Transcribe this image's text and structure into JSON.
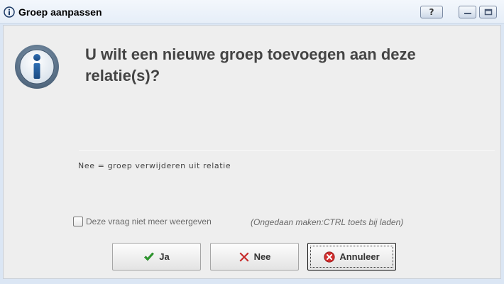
{
  "window": {
    "title": "Groep aanpassen",
    "title_icon": "info-circle-icon",
    "help_label": "?",
    "minimize_icon": "minimize-icon",
    "maximize_icon": "maximize-icon"
  },
  "dialog": {
    "icon": "info-icon",
    "question": "U wilt een nieuwe groep toevoegen aan deze relatie(s)?",
    "note": "Nee = groep verwijderen uit relatie",
    "checkbox_label": "Deze vraag niet meer weergeven",
    "checkbox_checked": false,
    "hint": "(Ongedaan maken:CTRL toets bij laden)"
  },
  "buttons": {
    "yes": {
      "label": "Ja",
      "icon": "check-icon",
      "color": "#2f9e2f"
    },
    "no": {
      "label": "Nee",
      "icon": "cross-icon",
      "color": "#c62828"
    },
    "cancel": {
      "label": "Annuleer",
      "icon": "cancel-circle-icon",
      "color": "#d32f2f"
    }
  },
  "colors": {
    "titlebar": "#e9f0f9",
    "content_bg": "#eeeeee",
    "question_text": "#444444"
  }
}
